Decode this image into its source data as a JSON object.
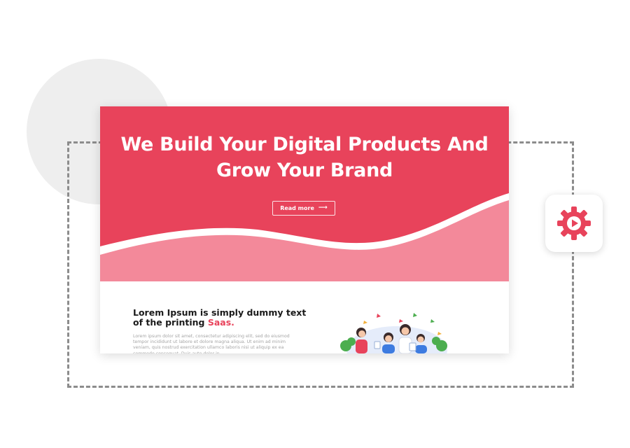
{
  "hero": {
    "title_line1": "We Build Your Digital Products And",
    "title_line2": "Grow Your Brand",
    "read_more_label": "Read more",
    "arrow_glyph": "⟶"
  },
  "content": {
    "heading_text": "Lorem Ipsum is simply dummy text of the printing ",
    "heading_accent": "Saas.",
    "paragraph": "Lorem ipsum dolor sit amet, consectetur adipiscing elit, sed do eiusmod tempor incididunt ut labore et dolore magna aliqua. Ut enim ad minim veniam, quis nostrud exercitation ullamco laboris nisi ut aliquip ex ea commodo consequat. Duis aute dolor in..."
  },
  "colors": {
    "brand": "#e8435b",
    "brand_light": "#f3899a",
    "frame_dash": "#8c8c8c",
    "background_circle": "#eeeeee"
  },
  "icons": {
    "badge_icon": "gear-play-icon",
    "illustration": "team-celebration-illustration"
  }
}
